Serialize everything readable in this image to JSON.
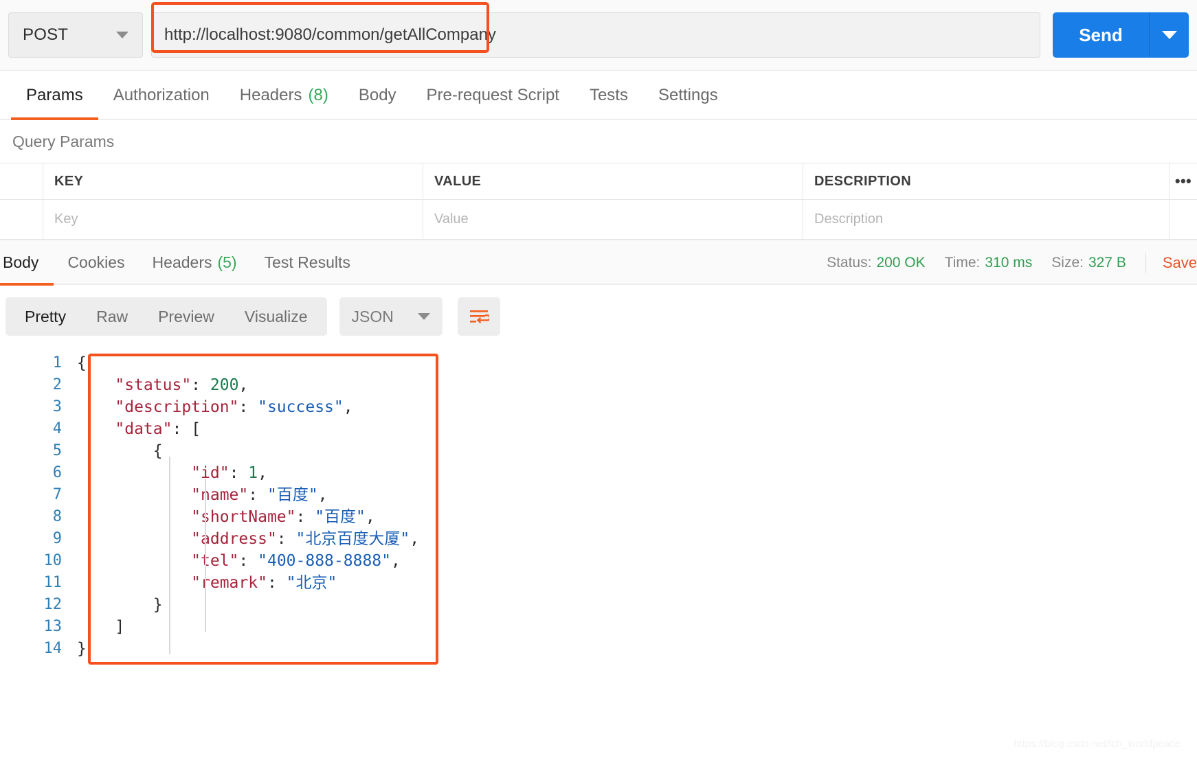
{
  "request_bar": {
    "method": "POST",
    "url": "http://localhost:9080/common/getAllCompany",
    "send_label": "Send",
    "highlight_color": "#f4511e",
    "send_color": "#1a7ee8"
  },
  "request_tabs": [
    {
      "label": "Params",
      "count": "",
      "active": true
    },
    {
      "label": "Authorization",
      "count": "",
      "active": false
    },
    {
      "label": "Headers",
      "count": "(8)",
      "active": false
    },
    {
      "label": "Body",
      "count": "",
      "active": false
    },
    {
      "label": "Pre-request Script",
      "count": "",
      "active": false
    },
    {
      "label": "Tests",
      "count": "",
      "active": false
    },
    {
      "label": "Settings",
      "count": "",
      "active": false
    }
  ],
  "query_params": {
    "section_title": "Query Params",
    "headers": {
      "key": "KEY",
      "value": "VALUE",
      "description": "DESCRIPTION",
      "more": "•••"
    },
    "row_placeholders": {
      "key": "Key",
      "value": "Value",
      "description": "Description"
    }
  },
  "response_tabs": [
    {
      "label": "Body",
      "count": "",
      "active": true
    },
    {
      "label": "Cookies",
      "count": "",
      "active": false
    },
    {
      "label": "Headers",
      "count": "(5)",
      "active": false
    },
    {
      "label": "Test Results",
      "count": "",
      "active": false
    }
  ],
  "response_meta": {
    "status_label": "Status:",
    "status_value": "200 OK",
    "time_label": "Time:",
    "time_value": "310 ms",
    "size_label": "Size:",
    "size_value": "327 B",
    "save_label": "Save",
    "ok_color": "#2f9e4f"
  },
  "body_toolbar": {
    "views": [
      {
        "label": "Pretty",
        "active": true
      },
      {
        "label": "Raw",
        "active": false
      },
      {
        "label": "Preview",
        "active": false
      },
      {
        "label": "Visualize",
        "active": false
      }
    ],
    "format": "JSON",
    "wrap_icon": "word-wrap-icon"
  },
  "response_body": {
    "language": "json",
    "lines": [
      {
        "no": "1",
        "tokens": [
          {
            "t": "{",
            "c": "p"
          }
        ]
      },
      {
        "no": "2",
        "tokens": [
          {
            "t": "    ",
            "c": "p"
          },
          {
            "t": "\"status\"",
            "c": "k"
          },
          {
            "t": ": ",
            "c": "p"
          },
          {
            "t": "200",
            "c": "n"
          },
          {
            "t": ",",
            "c": "p"
          }
        ]
      },
      {
        "no": "3",
        "tokens": [
          {
            "t": "    ",
            "c": "p"
          },
          {
            "t": "\"description\"",
            "c": "k"
          },
          {
            "t": ": ",
            "c": "p"
          },
          {
            "t": "\"success\"",
            "c": "s"
          },
          {
            "t": ",",
            "c": "p"
          }
        ]
      },
      {
        "no": "4",
        "tokens": [
          {
            "t": "    ",
            "c": "p"
          },
          {
            "t": "\"data\"",
            "c": "k"
          },
          {
            "t": ": ",
            "c": "p"
          },
          {
            "t": "[",
            "c": "p"
          }
        ]
      },
      {
        "no": "5",
        "tokens": [
          {
            "t": "        ",
            "c": "p"
          },
          {
            "t": "{",
            "c": "p"
          }
        ]
      },
      {
        "no": "6",
        "tokens": [
          {
            "t": "            ",
            "c": "p"
          },
          {
            "t": "\"id\"",
            "c": "k"
          },
          {
            "t": ": ",
            "c": "p"
          },
          {
            "t": "1",
            "c": "n"
          },
          {
            "t": ",",
            "c": "p"
          }
        ]
      },
      {
        "no": "7",
        "tokens": [
          {
            "t": "            ",
            "c": "p"
          },
          {
            "t": "\"name\"",
            "c": "k"
          },
          {
            "t": ": ",
            "c": "p"
          },
          {
            "t": "\"百度\"",
            "c": "s"
          },
          {
            "t": ",",
            "c": "p"
          }
        ]
      },
      {
        "no": "8",
        "tokens": [
          {
            "t": "            ",
            "c": "p"
          },
          {
            "t": "\"shortName\"",
            "c": "k"
          },
          {
            "t": ": ",
            "c": "p"
          },
          {
            "t": "\"百度\"",
            "c": "s"
          },
          {
            "t": ",",
            "c": "p"
          }
        ]
      },
      {
        "no": "9",
        "tokens": [
          {
            "t": "            ",
            "c": "p"
          },
          {
            "t": "\"address\"",
            "c": "k"
          },
          {
            "t": ": ",
            "c": "p"
          },
          {
            "t": "\"北京百度大厦\"",
            "c": "s"
          },
          {
            "t": ",",
            "c": "p"
          }
        ]
      },
      {
        "no": "10",
        "tokens": [
          {
            "t": "            ",
            "c": "p"
          },
          {
            "t": "\"tel\"",
            "c": "k"
          },
          {
            "t": ": ",
            "c": "p"
          },
          {
            "t": "\"400-888-8888\"",
            "c": "s"
          },
          {
            "t": ",",
            "c": "p"
          }
        ]
      },
      {
        "no": "11",
        "tokens": [
          {
            "t": "            ",
            "c": "p"
          },
          {
            "t": "\"remark\"",
            "c": "k"
          },
          {
            "t": ": ",
            "c": "p"
          },
          {
            "t": "\"北京\"",
            "c": "s"
          }
        ]
      },
      {
        "no": "12",
        "tokens": [
          {
            "t": "        ",
            "c": "p"
          },
          {
            "t": "}",
            "c": "p"
          }
        ]
      },
      {
        "no": "13",
        "tokens": [
          {
            "t": "    ",
            "c": "p"
          },
          {
            "t": "]",
            "c": "p"
          }
        ]
      },
      {
        "no": "14",
        "tokens": [
          {
            "t": "}",
            "c": "p"
          }
        ]
      }
    ]
  },
  "watermark": {
    "text": "https://blog.csdn.net/lch_worldpeace"
  }
}
